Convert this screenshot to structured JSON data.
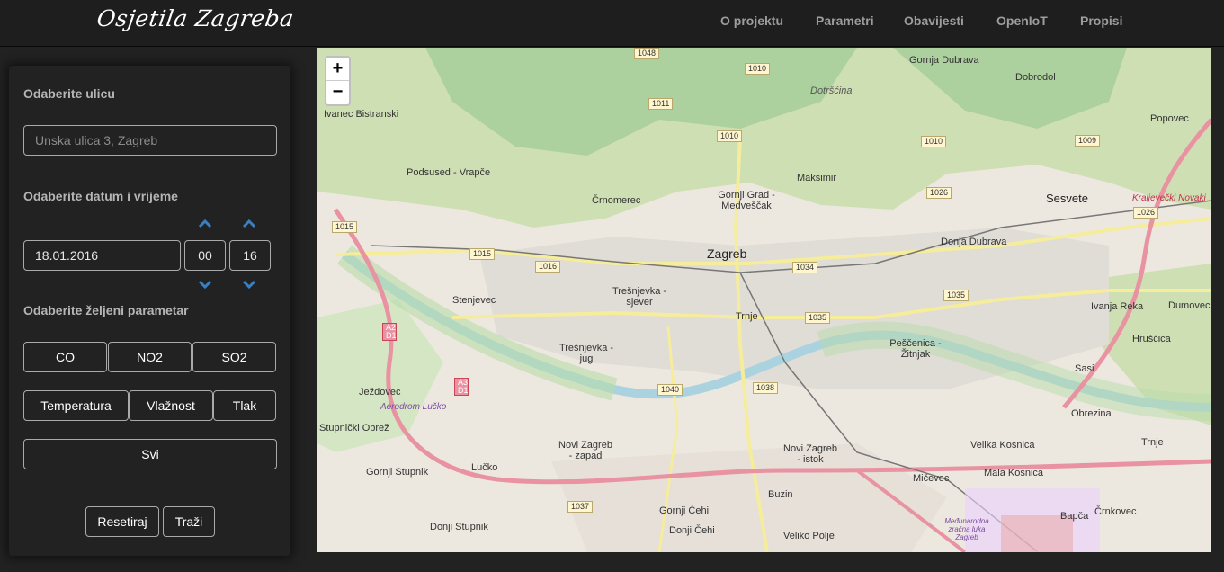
{
  "brand": "Osjetila Zagreba",
  "nav": [
    "O projektu",
    "Parametri",
    "Obavijesti",
    "OpenIoT",
    "Propisi"
  ],
  "form": {
    "street_label": "Odaberite ulicu",
    "street_placeholder": "Unska ulica 3, Zagreb",
    "datetime_label": "Odaberite datum i vrijeme",
    "date_value": "18.01.2016",
    "hour_value": "00",
    "minute_value": "16",
    "param_label": "Odaberite željeni parametar",
    "params_row1": [
      "CO",
      "NO2",
      "SO2"
    ],
    "params_row2": [
      "Temperatura",
      "Vlažnost",
      "Tlak"
    ],
    "all_label": "Svi",
    "reset_label": "Resetiraj",
    "search_label": "Traži"
  },
  "map": {
    "zoom_in": "+",
    "zoom_out": "−",
    "city_label": "Zagreb",
    "districts": [
      "Gornja Dubrava",
      "Dobrodol",
      "Popovec",
      "Sesvete",
      "Maksimir",
      "Gornji Grad - Medveščak",
      "Črnomerec",
      "Podsused - Vrapče",
      "Ivanec Bistranski",
      "Dotršćina",
      "Donja Dubrava",
      "Trešnjevka - sjever",
      "Stenjevec",
      "Trnje",
      "Peščenica - Žitnjak",
      "Ivanja Reka",
      "Dumovec",
      "Hrušćica",
      "Trešnjevka - jug",
      "Ježdovec",
      "Stupnički Obrež",
      "Lučko",
      "Novi Zagreb - zapad",
      "Novi Zagreb - istok",
      "Sasi",
      "Obrezina",
      "Velika Kosnica",
      "Mala Kosnica",
      "Mičevec",
      "Buzin",
      "Trnje",
      "Črnkovec",
      "Bapča",
      "Gornji Stupnik",
      "Donji Stupnik",
      "Gornji Čehi",
      "Donji Čehi",
      "Veliko Polje",
      "Kraljevečki Novaki",
      "Aerodrom Lučko",
      "Međunarodna zračna luka Zagreb"
    ],
    "roads": [
      "1048",
      "1010",
      "1011",
      "1010",
      "1010",
      "1009",
      "1026",
      "1026",
      "1015",
      "1015",
      "1016",
      "1034",
      "1035",
      "1035",
      "1040",
      "1038",
      "1037"
    ],
    "highway_labels": [
      "A2 D1",
      "A3 D1"
    ]
  },
  "colors": {
    "background": "#222222",
    "navbar": "#1e1e1e",
    "nav_text": "#9d9d9d",
    "chevron": "#3a7fc1",
    "field_border": "#aaaaaa"
  }
}
